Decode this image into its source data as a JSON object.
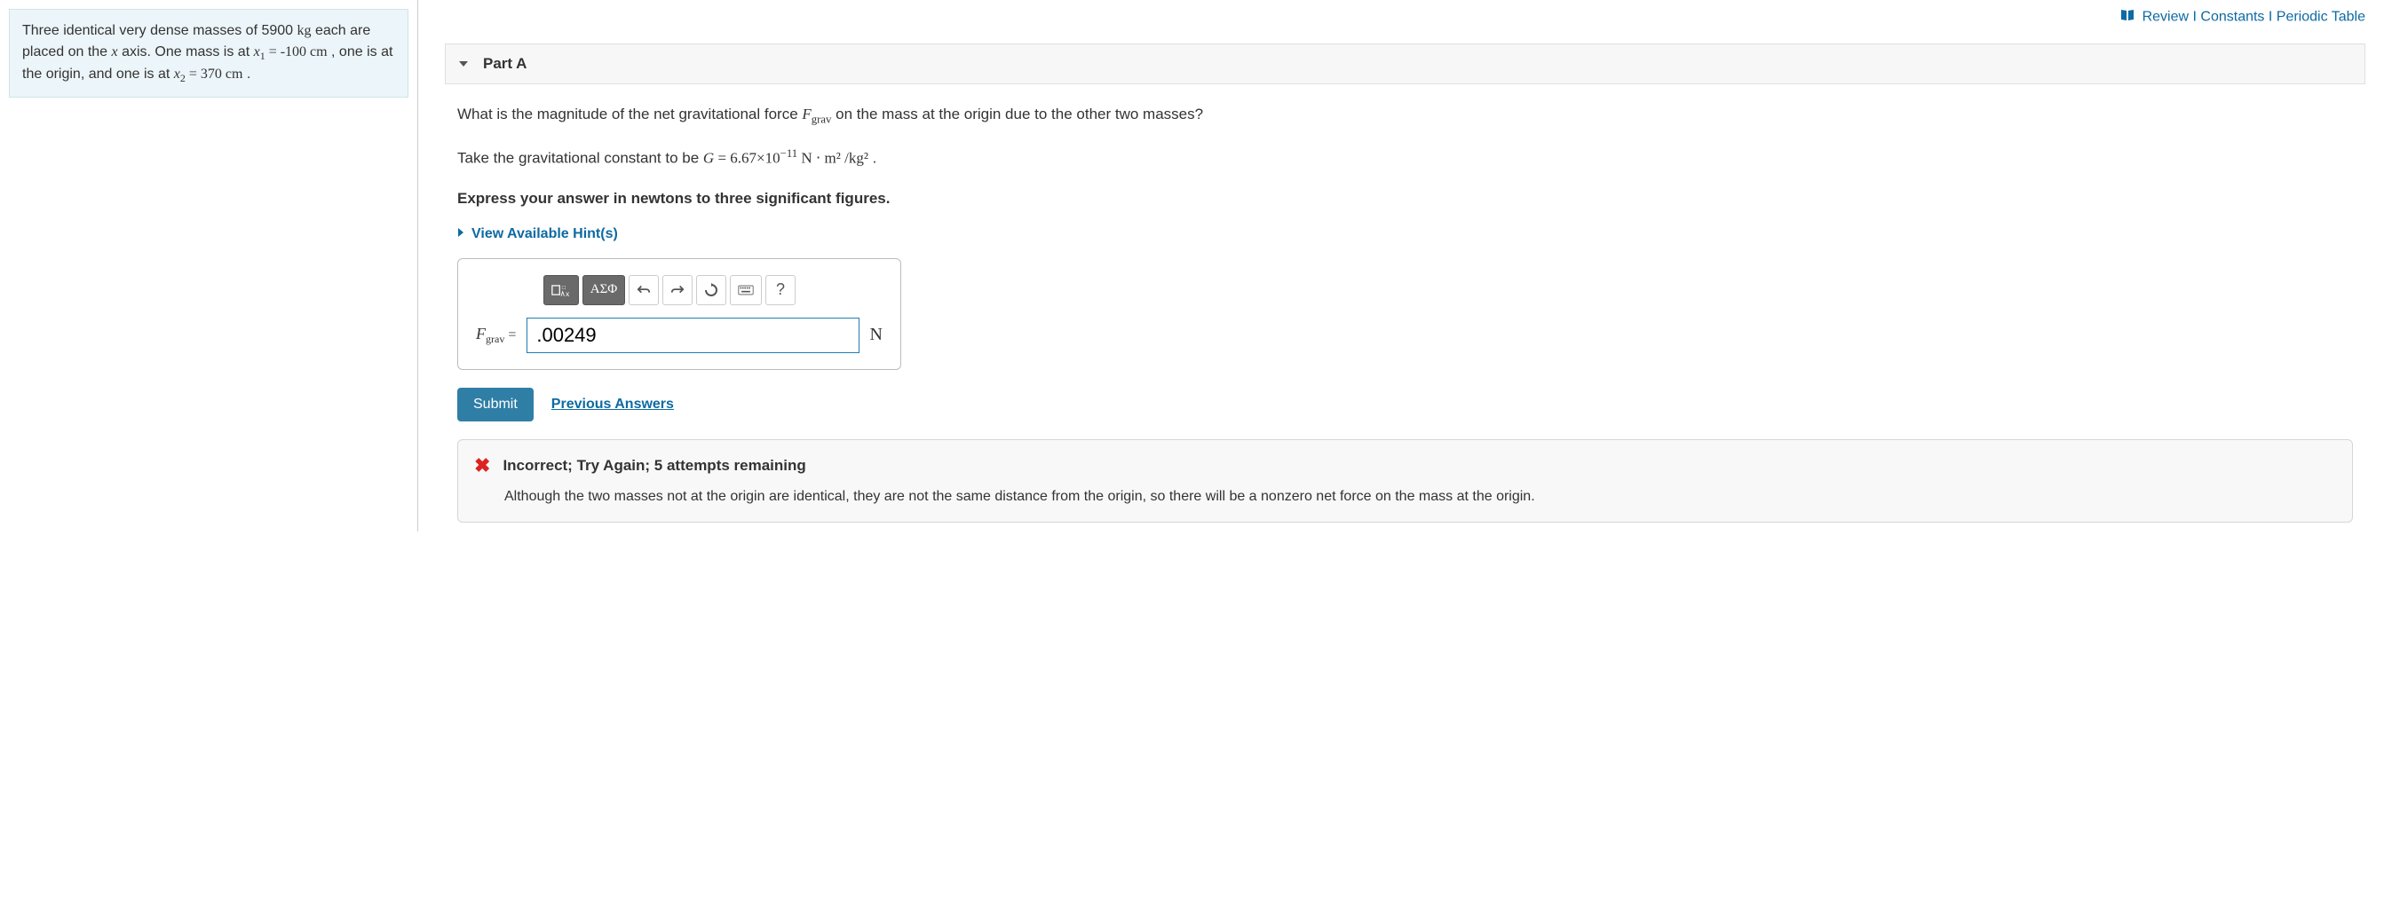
{
  "problem": {
    "text_pre": "Three identical very dense masses of 5900 ",
    "unit_kg": "kg",
    "text_mid1": " each are placed on the ",
    "xaxis": "x",
    "text_mid2": " axis. One mass is at ",
    "x1_var": "x",
    "x1_sub": "1",
    "text_eq1": " = -100 ",
    "unit_cm1": "cm",
    "text_mid3": " , one is at the origin, and one is at ",
    "x2_var": "x",
    "x2_sub": "2",
    "text_eq2": " = 370 ",
    "unit_cm2": "cm",
    "text_end": " ."
  },
  "top_links": {
    "review": "Review",
    "constants": "Constants",
    "periodic": "Periodic Table",
    "sep": " I "
  },
  "part": {
    "title": "Part A",
    "q1_pre": "What is the magnitude of the net gravitational force ",
    "q1_F": "F",
    "q1_sub": "grav",
    "q1_post": " on the mass at the origin due to the other two masses?",
    "q2_pre": "Take the gravitational constant to be ",
    "q2_G": "G",
    "q2_eq": " = 6.67×10",
    "q2_exp": "−11",
    "q2_units": " N ⋅ m² /kg²",
    "q2_end": " .",
    "q3": "Express your answer in newtons to three significant figures.",
    "hints": "View Available Hint(s)"
  },
  "toolbar": {
    "templates": "□√□",
    "greek": "ΑΣΦ",
    "help": "?"
  },
  "answer": {
    "F": "F",
    "sub": "grav",
    "eq": " = ",
    "value": ".00249",
    "unit": "N"
  },
  "buttons": {
    "submit": "Submit",
    "previous": "Previous Answers"
  },
  "feedback": {
    "header": "Incorrect; Try Again; 5 attempts remaining",
    "body": "Although the two masses not at the origin are identical, they are not the same distance from the origin, so there will be a nonzero net force on the mass at the origin."
  }
}
